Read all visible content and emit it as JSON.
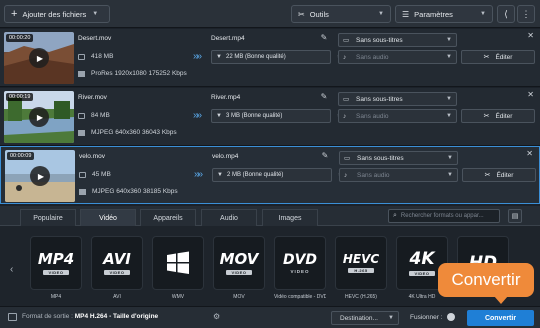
{
  "toolbar": {
    "add_files": "Ajouter des fichiers",
    "tools": "Outils",
    "settings": "Paramètres"
  },
  "files": [
    {
      "duration": "00:00:20",
      "name": "Desert.mov",
      "size": "418 MB",
      "info": "ProRes 1920x1080 175252 Kbps",
      "output_name": "Desert.mp4",
      "output_size": "22 MB (Bonne qualité)",
      "subtitles": "Sans sous-titres",
      "audio": "Sans audio",
      "edit_label": "Éditer"
    },
    {
      "duration": "00:00:19",
      "name": "River.mov",
      "size": "84 MB",
      "info": "MJPEG 640x360 36043 Kbps",
      "output_name": "River.mp4",
      "output_size": "3 MB (Bonne qualité)",
      "subtitles": "Sans sous-titres",
      "audio": "Sans audio",
      "edit_label": "Éditer"
    },
    {
      "duration": "00:00:09",
      "name": "velo.mov",
      "size": "45 MB",
      "info": "MJPEG 640x360 38185 Kbps",
      "output_name": "velo.mp4",
      "output_size": "2 MB (Bonne qualité)",
      "subtitles": "Sans sous-titres",
      "audio": "Sans audio",
      "edit_label": "Éditer"
    }
  ],
  "format_tabs": [
    "Populaire",
    "Vidéo",
    "Appareils",
    "Audio",
    "Images"
  ],
  "active_tab": "Vidéo",
  "search_placeholder": "Rechercher formats ou appar...",
  "formats": [
    {
      "logo": "MP4",
      "sub": "VIDEO",
      "caption": "MP4"
    },
    {
      "logo": "AVI",
      "sub": "VIDEO",
      "caption": "AVI"
    },
    {
      "logo": "",
      "sub": "",
      "caption": "WMV"
    },
    {
      "logo": "MOV",
      "sub": "VIDEO",
      "caption": "MOV"
    },
    {
      "logo": "DVD",
      "sub": "VIDEO",
      "caption": "Vidéo compatible - DVD"
    },
    {
      "logo": "HEVC",
      "sub": "H.265",
      "caption": "HEVC (H.265)"
    },
    {
      "logo": "4K",
      "sub": "VIDEO",
      "caption": "4K Ultra HD"
    },
    {
      "logo": "HD",
      "sub": "",
      "caption": ""
    }
  ],
  "bottom": {
    "output_format_label": "Format de sortie :",
    "output_format_value": "MP4 H.264 - Taille d'origine",
    "destination": "Destination...",
    "merge": "Fusionner :",
    "convert": "Convertir"
  },
  "callout": "Convertir",
  "colors": {
    "accent": "#1f7fd6",
    "callout": "#ef8a3a",
    "selection_border": "#3b8fd6"
  }
}
